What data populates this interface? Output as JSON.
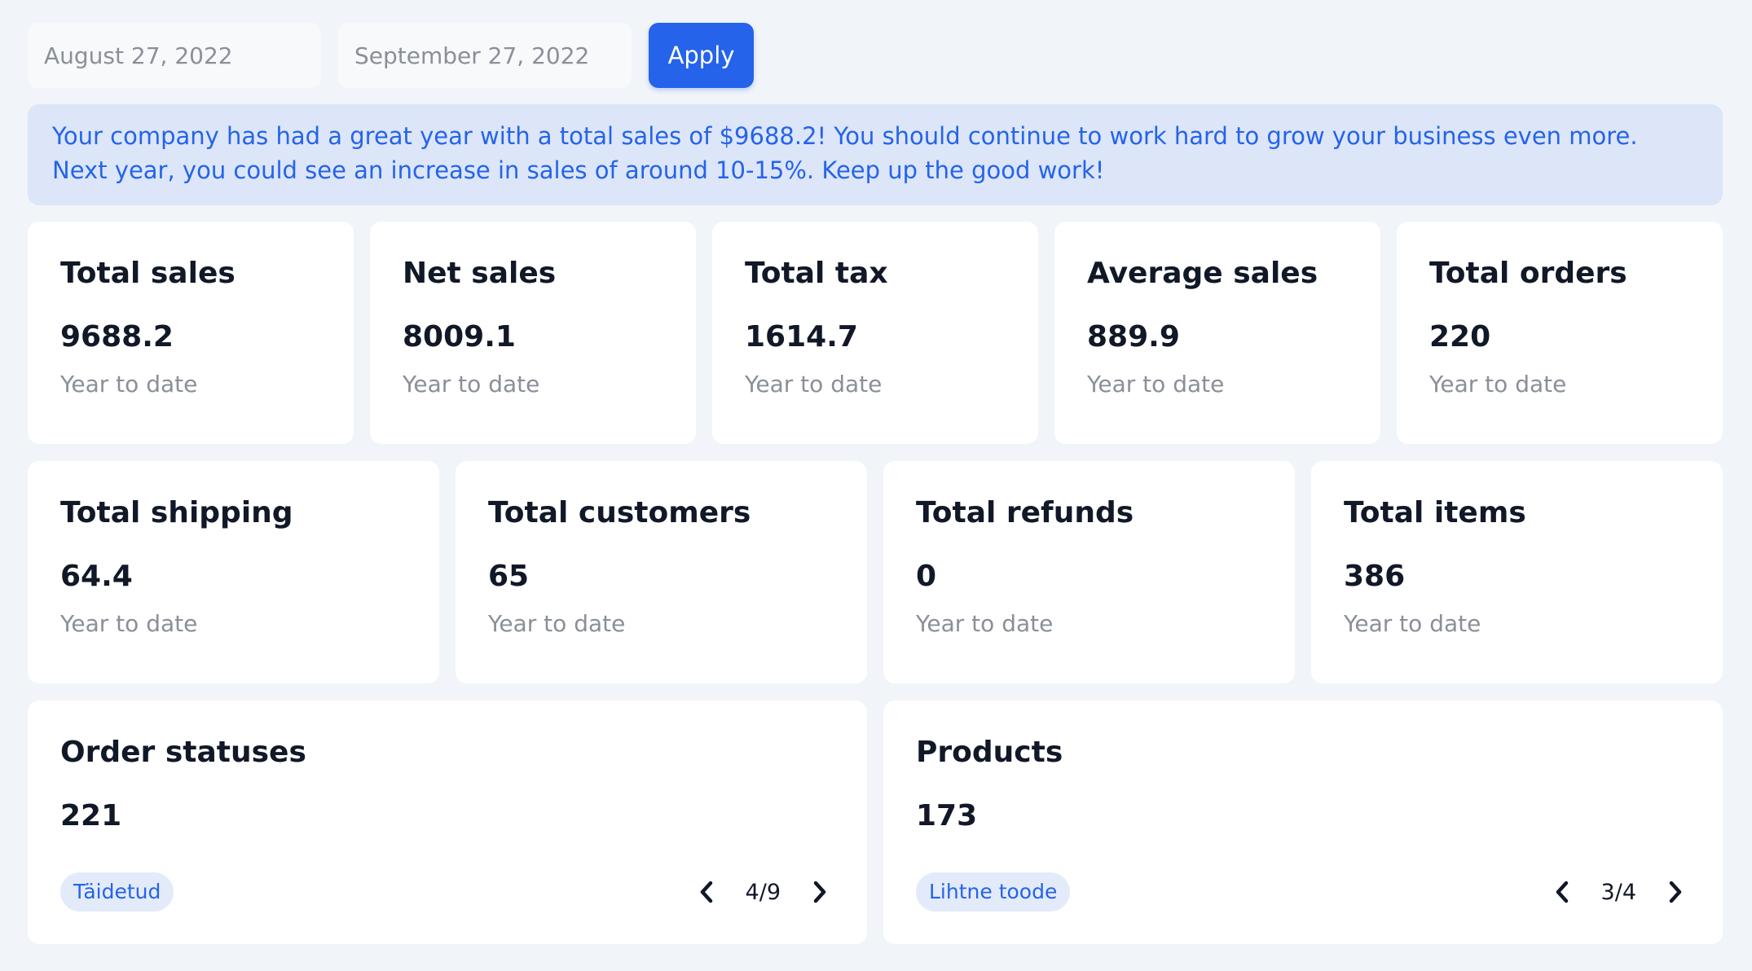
{
  "filters": {
    "start_date": "August 27, 2022",
    "end_date": "September 27, 2022",
    "apply_label": "Apply"
  },
  "banner": {
    "message": "Your company has had a great year with a total sales of $9688.2! You should continue to work hard to grow your business even more. Next year, you could see an increase in sales of around 10-15%. Keep up the good work!"
  },
  "stats_row1": [
    {
      "title": "Total sales",
      "value": "9688.2",
      "sub": "Year to date"
    },
    {
      "title": "Net sales",
      "value": "8009.1",
      "sub": "Year to date"
    },
    {
      "title": "Total tax",
      "value": "1614.7",
      "sub": "Year to date"
    },
    {
      "title": "Average sales",
      "value": "889.9",
      "sub": "Year to date"
    },
    {
      "title": "Total orders",
      "value": "220",
      "sub": "Year to date"
    }
  ],
  "stats_row2": [
    {
      "title": "Total shipping",
      "value": "64.4",
      "sub": "Year to date"
    },
    {
      "title": "Total customers",
      "value": "65",
      "sub": "Year to date"
    },
    {
      "title": "Total refunds",
      "value": "0",
      "sub": "Year to date"
    },
    {
      "title": "Total items",
      "value": "386",
      "sub": "Year to date"
    }
  ],
  "order_statuses": {
    "title": "Order statuses",
    "value": "221",
    "badge": "Täidetud",
    "pager": "4/9"
  },
  "products": {
    "title": "Products",
    "value": "173",
    "badge": "Lihtne toode",
    "pager": "3/4"
  },
  "icons": {
    "prev": "chevron-left-icon",
    "next": "chevron-right-icon"
  },
  "colors": {
    "accent": "#2563eb",
    "banner_bg": "#dce6f8",
    "page_bg": "#f1f4f9",
    "muted_text": "#8a8f98"
  }
}
